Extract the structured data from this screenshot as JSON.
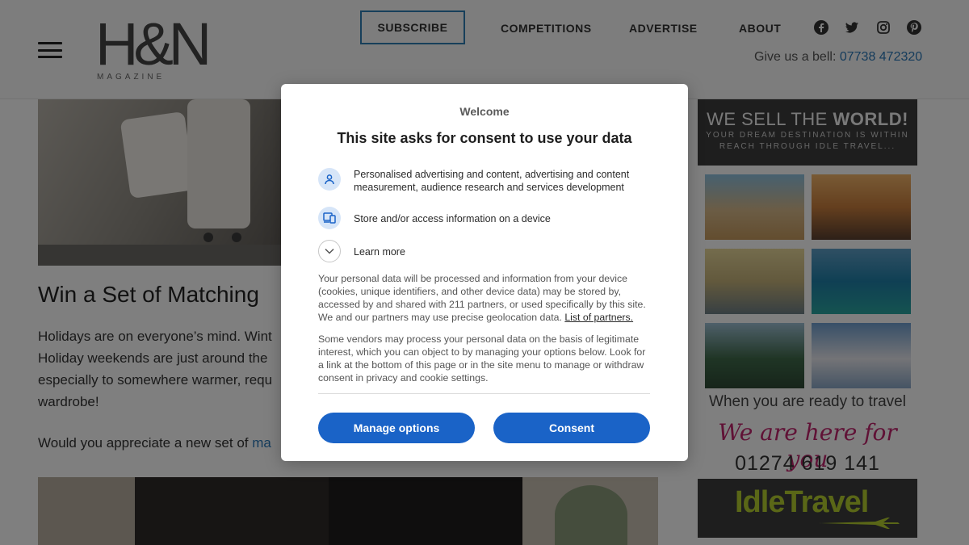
{
  "header": {
    "logo_text": "H&N",
    "logo_subtitle": "MAGAZINE",
    "nav": {
      "subscribe": "SUBSCRIBE",
      "competitions": "COMPETITIONS",
      "advertise": "ADVERTISE",
      "about": "ABOUT"
    },
    "social_icons": [
      "facebook-icon",
      "twitter-icon",
      "instagram-icon",
      "pinterest-icon"
    ],
    "bell_label": "Give us a bell:",
    "bell_phone": "07738 472320"
  },
  "article": {
    "title": "Win a Set of Matching",
    "paragraph_lines": [
      "Holidays are on everyone’s mind. Wint",
      "Holiday weekends are just around the",
      "especially to somewhere warmer, requ",
      "wardrobe!"
    ],
    "para2_prefix": "Would you appreciate a new set of",
    "para2_link": "ma"
  },
  "ad": {
    "headline_normal": "WE SELL THE",
    "headline_bold": "WORLD!",
    "tagline_1": "YOUR DREAM DESTINATION IS WITHIN",
    "tagline_2": "REACH THROUGH IDLE TRAVEL...",
    "ready_text": "When you are ready to travel",
    "script_text": "We are here for you",
    "phone": "01274 619 141",
    "brand": "IdleTravel"
  },
  "consent": {
    "welcome": "Welcome",
    "title": "This site asks for consent to use your data",
    "purposes": [
      {
        "icon": "person-icon",
        "text": "Personalised advertising and content, advertising and content measurement, audience research and services development"
      },
      {
        "icon": "device-icon",
        "text": "Store and/or access information on a device"
      }
    ],
    "learn_more": "Learn more",
    "body_1": "Your personal data will be processed and information from your device (cookies, unique identifiers, and other device data) may be stored by, accessed by and shared with 211 partners, or used specifically by this site. We and our partners may use precise geolocation data.",
    "partners_link": "List of partners.",
    "body_2": "Some vendors may process your personal data on the basis of legitimate interest, which you can object to by managing your options below. Look for a link at the bottom of this page or in the site menu to manage or withdraw consent in privacy and cookie settings.",
    "manage_button": "Manage options",
    "consent_button": "Consent"
  },
  "colors": {
    "accent_blue": "#1a63c7",
    "link_blue": "#2b78b8",
    "ad_pink": "#c0246d",
    "ad_green": "#b5cf2f"
  }
}
